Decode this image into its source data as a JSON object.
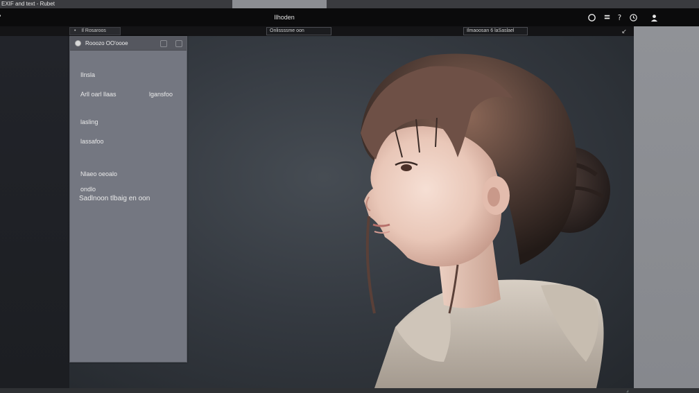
{
  "window": {
    "title": "EXIF and text - Rubet"
  },
  "toolbar": {
    "title": "Ilhoden"
  },
  "subbar": {
    "tab_label": "Il Rosaroos",
    "center_field": "Onlissssme oon",
    "right_field": "Ilmaoosan 6 laSaslael"
  },
  "panel": {
    "title": "Rooozo OO'oooe",
    "rows": [
      {
        "label": "Ilnsla"
      },
      {
        "label": "Arll oarl llaas",
        "value": "lgansfoo"
      },
      {
        "label": "lasling"
      },
      {
        "label": "lassafoo"
      },
      {
        "label": "Nlaeo oeoalo"
      },
      {
        "label": "ondlo"
      },
      {
        "label": "Sadlnoon tlbaig en oon"
      }
    ]
  },
  "icons": {
    "toolbar": [
      "circle-icon",
      "stack-icon",
      "help-icon",
      "history-icon",
      "user-icon"
    ]
  },
  "colors": {
    "panel_bg": "#747781",
    "toolbar_bg": "#0b0b0c",
    "right_panel": "#8b8d92",
    "canvas_bg": "#353a41"
  }
}
